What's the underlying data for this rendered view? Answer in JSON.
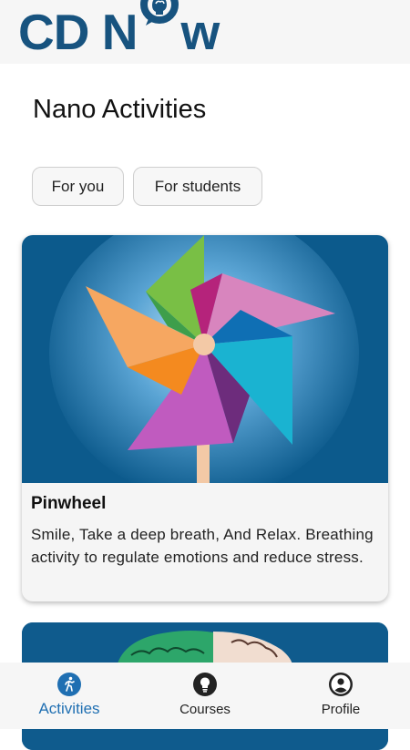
{
  "header": {
    "logo_left": "CD N",
    "logo_right": "w"
  },
  "page": {
    "title": "Nano Activities"
  },
  "filters": [
    {
      "label": "For you"
    },
    {
      "label": "For students"
    }
  ],
  "cards": [
    {
      "title": "Pinwheel",
      "description": "Smile, Take a deep breath, And Relax. Breathing activity to regulate emotions and reduce stress."
    }
  ],
  "nav": {
    "items": [
      {
        "label": "Activities",
        "icon": "running-person-icon",
        "active": true
      },
      {
        "label": "Courses",
        "icon": "lightbulb-icon",
        "active": false
      },
      {
        "label": "Profile",
        "icon": "account-circle-icon",
        "active": false
      }
    ]
  },
  "colors": {
    "brand": "#17537f",
    "accent": "#1f6fb2",
    "card_bg": "#0f5b8d"
  }
}
